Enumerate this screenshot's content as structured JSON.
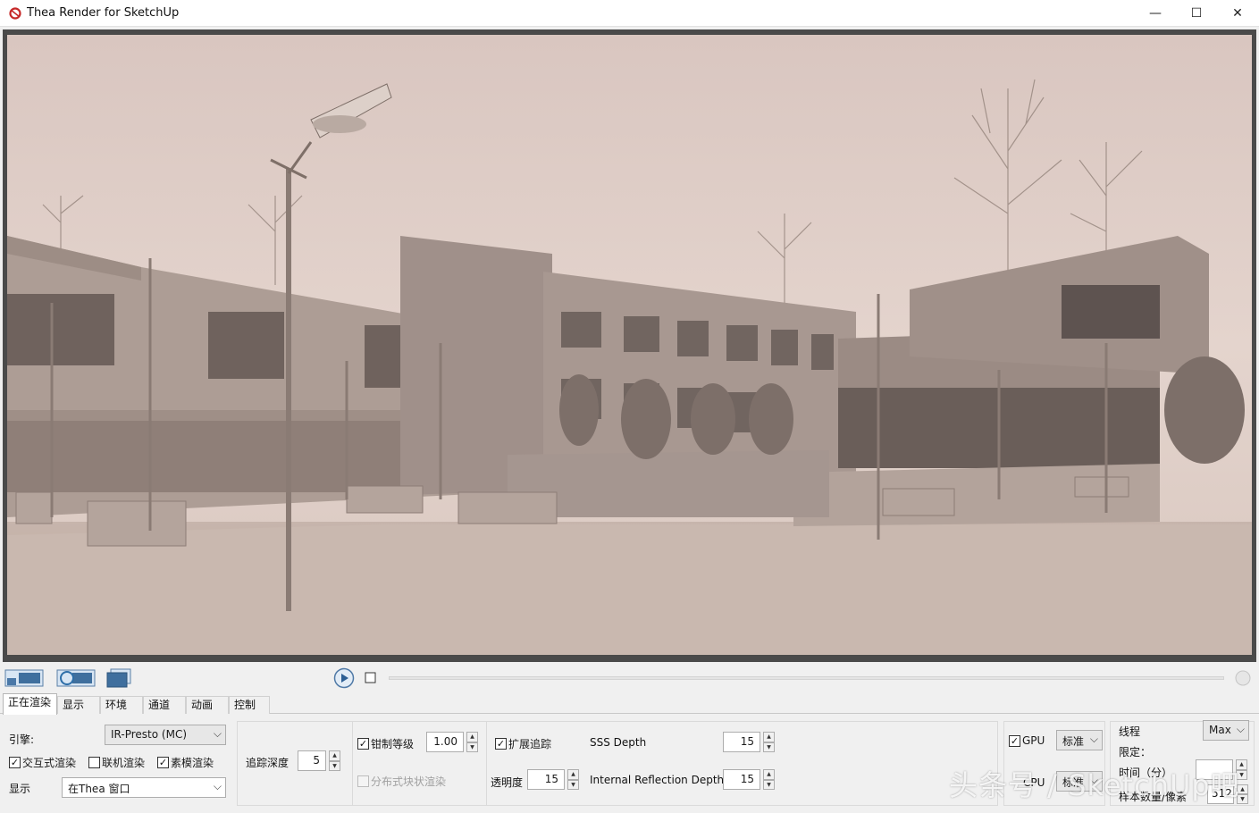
{
  "window": {
    "title": "Thea Render for SketchUp",
    "minimize": "—",
    "maximize": "☐",
    "close": "✕"
  },
  "render": {
    "image": "render-preview"
  },
  "toolbar": {
    "buttons": [
      "save-image-icon",
      "refresh-render-icon",
      "copy-window-icon",
      "play-icon",
      "stop-icon"
    ]
  },
  "tabs": [
    {
      "label": "正在渲染",
      "active": true
    },
    {
      "label": "显示"
    },
    {
      "label": "环境"
    },
    {
      "label": "通道"
    },
    {
      "label": "动画"
    },
    {
      "label": "控制台"
    }
  ],
  "engine": {
    "label": "引擎:",
    "value": "IR-Presto (MC)",
    "interactive": {
      "label": "交互式渲染",
      "checked": true
    },
    "network": {
      "label": "联机渲染",
      "checked": false
    },
    "clay": {
      "label": "素模渲染",
      "checked": true
    },
    "display_label": "显示",
    "display_value": "在Thea 窗口"
  },
  "trace": {
    "depth_label": "追踪深度",
    "depth_value": "5"
  },
  "clamp": {
    "label": "钳制等级",
    "checked": true,
    "value": "1.00",
    "distributed_label": "分布式块状渲染",
    "distributed_checked": false
  },
  "extended": {
    "label": "扩展追踪",
    "checked": true,
    "transparency_label": "透明度",
    "transparency_value": "15",
    "sss_label": "SSS Depth",
    "sss_value": "15",
    "ird_label": "Internal Reflection Depth",
    "ird_value": "15"
  },
  "device": {
    "gpu_label": "GPU",
    "gpu_checked": true,
    "gpu_mode": "标准",
    "cpu_label": "CPU",
    "cpu_mode": "标准"
  },
  "limits": {
    "threads_label": "线程",
    "threads_value": "Max",
    "limit_label": "限定：",
    "time_label": "时间（分）",
    "samples_label": "样本数量/像素",
    "samples_value": "512"
  },
  "watermark": "头条号 / SketchUp吧",
  "colors": {
    "sky": "#e6d6cf",
    "building": "#a89890",
    "ground": "#c7b6ad",
    "viewport_frame": "#4a4a4a"
  }
}
